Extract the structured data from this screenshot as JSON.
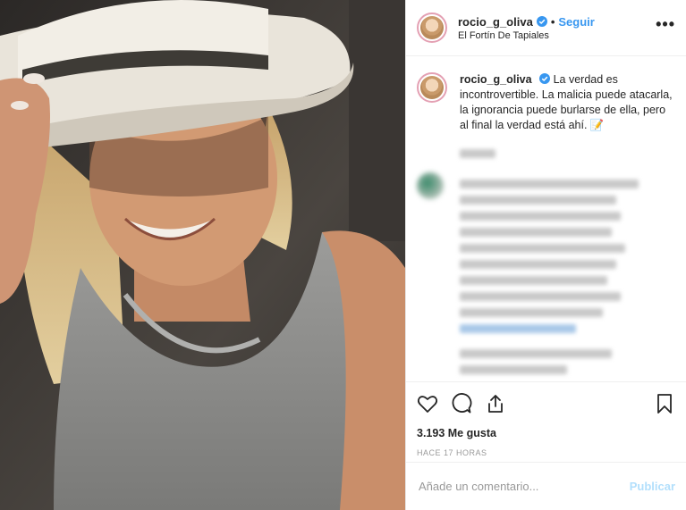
{
  "post": {
    "username": "rocio_g_oliva",
    "follow_label": "Seguir",
    "separator": "•",
    "location": "El Fortín De Tapiales",
    "more_label": "•••"
  },
  "caption": {
    "username": "rocio_g_oliva",
    "text": "La verdad es incontrovertible. La malicia puede atacarla, la ignorancia puede burlarse de ella, pero al final la verdad está ahí. 📝"
  },
  "stats": {
    "likes": "3.193 Me gusta",
    "time": "HACE 17 HORAS"
  },
  "comment_box": {
    "placeholder": "Añade un comentario...",
    "publish_label": "Publicar"
  },
  "colors": {
    "accent": "#3897f0",
    "publish_disabled": "#b2dffc",
    "verified": "#3897f0"
  },
  "icons": [
    "heart-icon",
    "comment-icon",
    "share-icon",
    "bookmark-icon",
    "verified-icon"
  ]
}
